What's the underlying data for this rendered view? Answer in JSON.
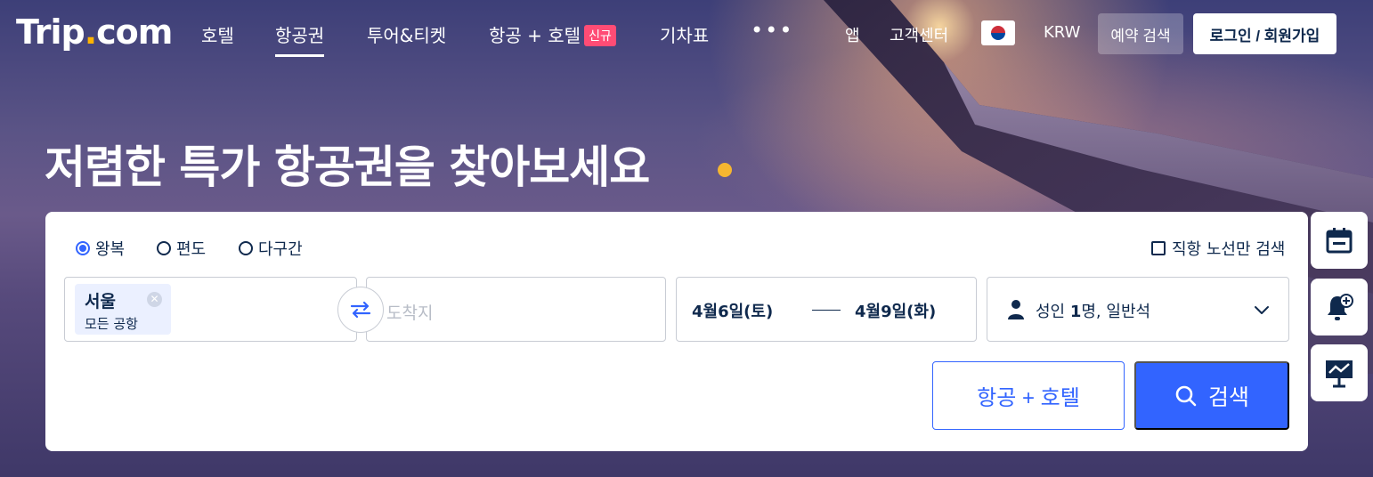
{
  "nav": {
    "logo_main": "Trip",
    "logo_dot": ".",
    "logo_tld": "com",
    "items": [
      {
        "label": "호텔"
      },
      {
        "label": "항공권"
      },
      {
        "label": "투어&티켓"
      },
      {
        "label": "항공 + 호텔"
      },
      {
        "label": "기차표"
      }
    ],
    "new_badge": "신규",
    "more": "•••",
    "app": "앱",
    "support": "고객센터",
    "flag_icon": "korea-flag-icon",
    "currency": "KRW",
    "booking_search": "예약 검색",
    "login": "로그인 / 회원가입"
  },
  "hero": {
    "headline": "저렴한 특가 항공권을 찾아보세요"
  },
  "search": {
    "trip_types": [
      {
        "label": "왕복",
        "checked": true
      },
      {
        "label": "편도",
        "checked": false
      },
      {
        "label": "다구간",
        "checked": false
      }
    ],
    "direct_only": "직항 노선만 검색",
    "origin_city": "서울",
    "origin_sub": "모든 공항",
    "destination_placeholder": "도착지",
    "depart_date": "4월6일(토)",
    "return_date": "4월9일(화)",
    "passengers_prefix": "성인 ",
    "passengers_count": "1",
    "passengers_suffix": "명, 일반석",
    "flight_hotel_button": "항공 + 호텔",
    "search_button": "검색"
  },
  "colors": {
    "primary": "#3264ff",
    "text": "#0f294d",
    "badge": "#ff4c75",
    "accent_dot": "#f5b630"
  }
}
